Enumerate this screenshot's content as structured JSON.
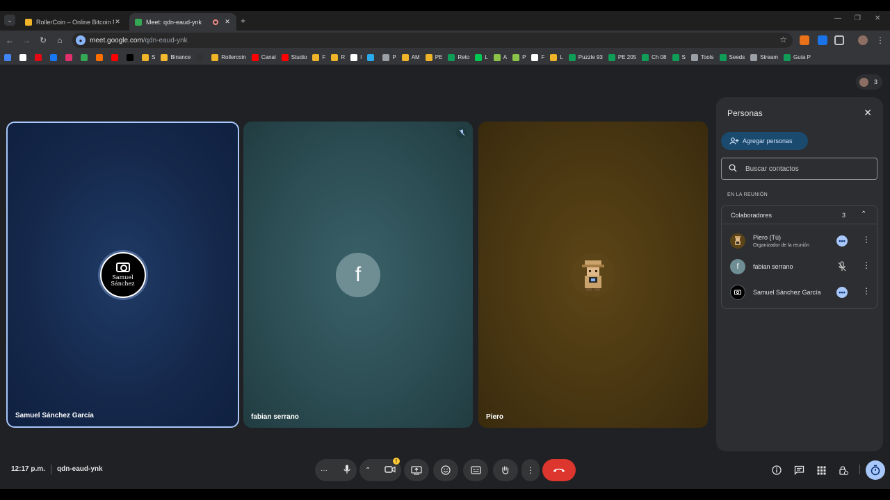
{
  "browser": {
    "tabs": [
      {
        "title": "RollerCoin – Online Bitcoin Mi",
        "favicon_color": "#f0b429"
      },
      {
        "title": "Meet: qdn-eaud-ynk",
        "favicon_color": "#34a853"
      }
    ],
    "url_host": "meet.google.com",
    "url_path": "/qdn-eaud-ynk",
    "bookmarks": [
      {
        "label": "",
        "color": "#4285f4"
      },
      {
        "label": "",
        "color": "#ffffff"
      },
      {
        "label": "",
        "color": "#e50914"
      },
      {
        "label": "",
        "color": "#1877f2"
      },
      {
        "label": "",
        "color": "#e1306c"
      },
      {
        "label": "",
        "color": "#34a853"
      },
      {
        "label": "",
        "color": "#ff6f00"
      },
      {
        "label": "",
        "color": "#ff0000"
      },
      {
        "label": "",
        "color": "#000000"
      },
      {
        "label": "S",
        "color": "#f0b429"
      },
      {
        "label": "Binance",
        "color": "#f3ba2f"
      },
      {
        "label": "",
        "color": "#333333"
      },
      {
        "label": "Rollercoin",
        "color": "#f0b429"
      },
      {
        "label": "Canal",
        "color": "#ff0000"
      },
      {
        "label": "Studio",
        "color": "#ff0000"
      },
      {
        "label": "F",
        "color": "#f0b429"
      },
      {
        "label": "R",
        "color": "#f0b429"
      },
      {
        "label": "I",
        "color": "#ffffff"
      },
      {
        "label": "",
        "color": "#2aabee"
      },
      {
        "label": "P",
        "color": "#9aa0a6"
      },
      {
        "label": "AM",
        "color": "#f0b429"
      },
      {
        "label": "PE",
        "color": "#f0b429"
      },
      {
        "label": "Reto",
        "color": "#0f9d58"
      },
      {
        "label": "L",
        "color": "#00c853"
      },
      {
        "label": "A",
        "color": "#8bc34a"
      },
      {
        "label": "P",
        "color": "#8bc34a"
      },
      {
        "label": "F",
        "color": "#ffffff"
      },
      {
        "label": "L",
        "color": "#f0b429"
      },
      {
        "label": "Puzzle 93",
        "color": "#0f9d58"
      },
      {
        "label": "PE 205",
        "color": "#0f9d58"
      },
      {
        "label": "Ch 08",
        "color": "#0f9d58"
      },
      {
        "label": "S",
        "color": "#0f9d58"
      },
      {
        "label": "Tools",
        "color": "#9aa0a6"
      },
      {
        "label": "Seeds",
        "color": "#0f9d58"
      },
      {
        "label": "Stream",
        "color": "#9aa0a6"
      },
      {
        "label": "Guía P",
        "color": "#0f9d58"
      }
    ]
  },
  "meeting": {
    "participant_count": "3",
    "tiles": [
      {
        "name": "Samuel Sánchez García",
        "avatar_text": "Samuel Sánchez"
      },
      {
        "name": "fabian serrano",
        "avatar_text": "f"
      },
      {
        "name": "Piero"
      }
    ],
    "time": "12:17 p.m.",
    "code": "qdn-eaud-ynk"
  },
  "panel": {
    "title": "Personas",
    "add_label": "Agregar personas",
    "search_placeholder": "Buscar contactos",
    "section_label": "EN LA REUNIÓN",
    "group_label": "Colaboradores",
    "group_count": "3",
    "people": [
      {
        "name": "Piero (Tú)",
        "role": "Organizador de la reunión",
        "avatar_color": "#5a4418"
      },
      {
        "name": "fabian serrano",
        "role": "",
        "avatar_text": "f",
        "avatar_color": "#6e8e93"
      },
      {
        "name": "Samuel Sánchez García",
        "role": "",
        "avatar_color": "#000000"
      }
    ]
  },
  "colors": {
    "accent": "#a8c7fa",
    "end_call": "#dc362e"
  }
}
